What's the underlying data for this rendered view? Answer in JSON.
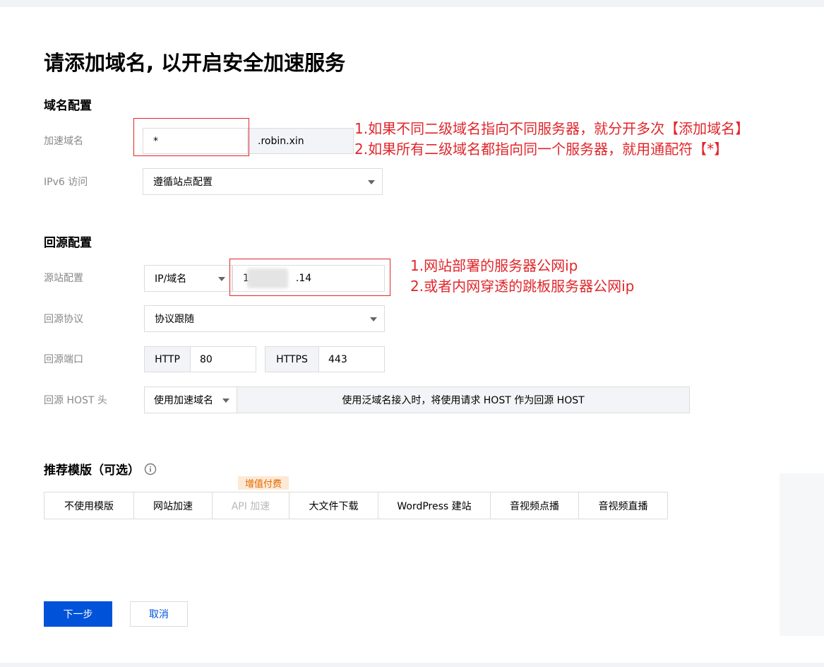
{
  "page": {
    "title": "请添加域名, 以开启安全加速服务"
  },
  "domain_config": {
    "section_title": "域名配置",
    "accel_domain_label": "加速域名",
    "accel_domain_value": "*",
    "accel_domain_suffix": ".robin.xin",
    "ipv6_label": "IPv6 访问",
    "ipv6_value": "遵循站点配置"
  },
  "origin_config": {
    "section_title": "回源配置",
    "origin_label": "源站配置",
    "origin_type": "IP/域名",
    "origin_value_prefix": "1",
    "origin_value_suffix": ".14",
    "protocol_label": "回源协议",
    "protocol_value": "协议跟随",
    "port_label": "回源端口",
    "http_label": "HTTP",
    "http_port": "80",
    "https_label": "HTTPS",
    "https_port": "443",
    "host_label": "回源 HOST 头",
    "host_value": "使用加速域名",
    "host_hint": "使用泛域名接入时，将使用请求 HOST 作为回源 HOST"
  },
  "templates": {
    "section_title": "推荐模版（可选）",
    "badge": "增值付费",
    "items": [
      {
        "label": "不使用模版",
        "disabled": false
      },
      {
        "label": "网站加速",
        "disabled": false
      },
      {
        "label": "API 加速",
        "disabled": true
      },
      {
        "label": "大文件下载",
        "disabled": false
      },
      {
        "label": "WordPress 建站",
        "disabled": false
      },
      {
        "label": "音视频点播",
        "disabled": false
      },
      {
        "label": "音视频直播",
        "disabled": false
      }
    ]
  },
  "annotations": {
    "domain_note_1": "1.如果不同二级域名指向不同服务器，就分开多次【添加域名】",
    "domain_note_2": "2.如果所有二级域名都指向同一个服务器，就用通配符【*】",
    "origin_note_1": "1.网站部署的服务器公网ip",
    "origin_note_2": "2.或者内网穿透的跳板服务器公网ip"
  },
  "actions": {
    "next_label": "下一步",
    "cancel_label": "取消"
  },
  "colors": {
    "primary": "#0052d9",
    "annotation_red": "#e0262b",
    "badge_bg": "#fde9d6",
    "badge_text": "#e26a00"
  },
  "icons": {
    "info": "info-circle-icon",
    "dropdown": "caret-down-icon"
  }
}
